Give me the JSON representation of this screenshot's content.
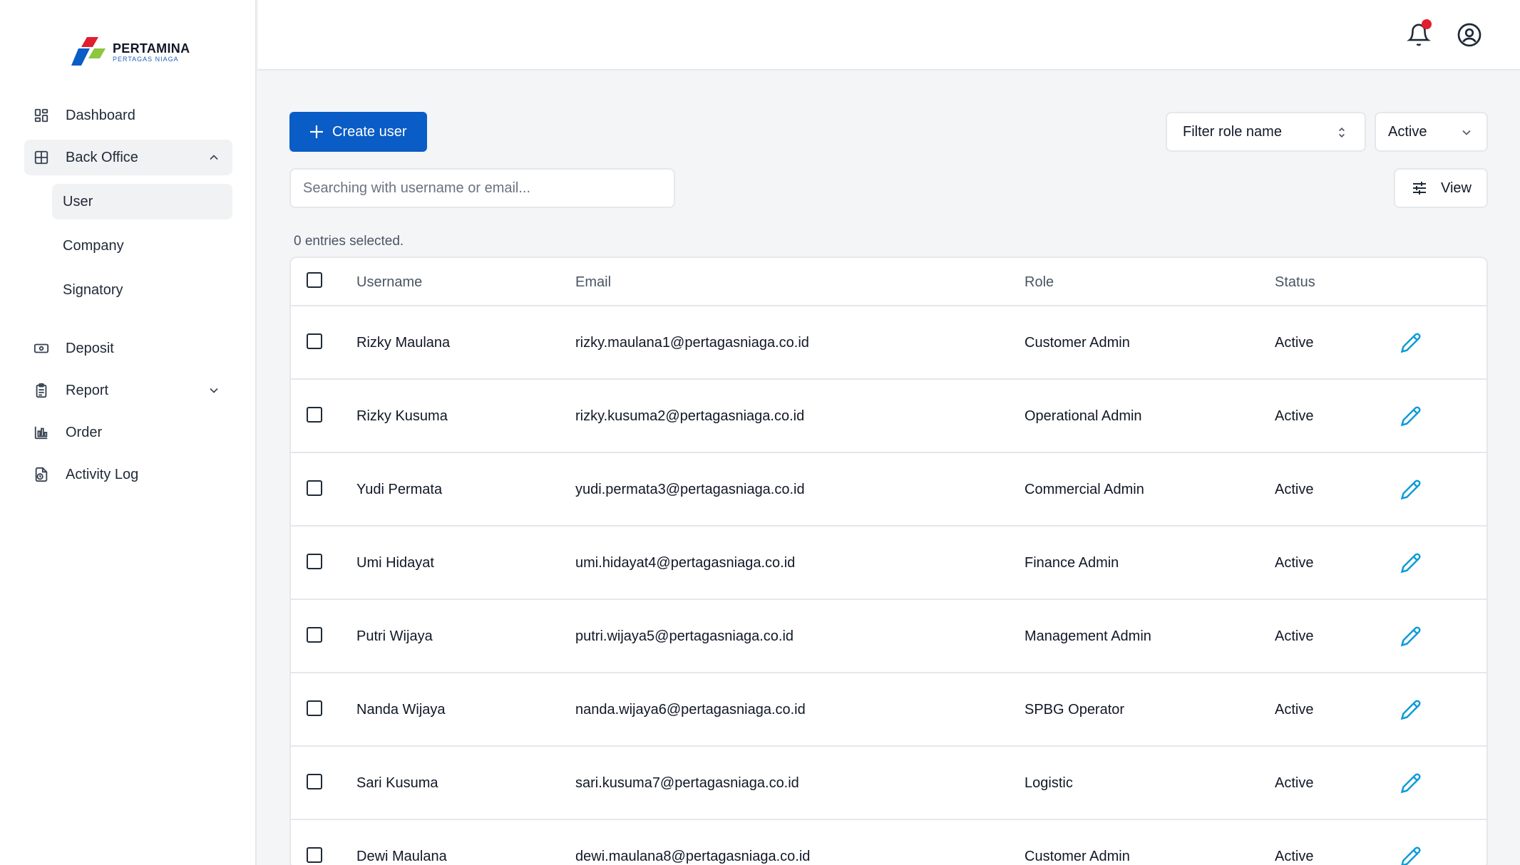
{
  "brand": {
    "name": "PERTAMINA",
    "subtitle": "PERTAGAS NIAGA"
  },
  "sidebar": {
    "items": [
      {
        "label": "Dashboard",
        "icon": "dashboard-grid-icon"
      },
      {
        "label": "Back Office",
        "icon": "table-grid-icon",
        "expanded": true,
        "children": [
          {
            "label": "User",
            "active": true
          },
          {
            "label": "Company"
          },
          {
            "label": "Signatory"
          }
        ]
      },
      {
        "label": "Deposit",
        "icon": "banknote-icon"
      },
      {
        "label": "Report",
        "icon": "clipboard-icon",
        "expanded": false
      },
      {
        "label": "Order",
        "icon": "bar-chart-icon"
      },
      {
        "label": "Activity Log",
        "icon": "file-clock-icon"
      }
    ]
  },
  "header": {
    "notification_icon": "bell-icon",
    "has_notification": true,
    "account_icon": "user-circle-icon"
  },
  "toolbar": {
    "create_label": "Create user",
    "role_filter_label": "Filter role name",
    "status_filter_value": "Active",
    "search_placeholder": "Searching with username or email...",
    "view_label": "View"
  },
  "selection": {
    "text": "0 entries selected."
  },
  "table": {
    "columns": [
      "Username",
      "Email",
      "Role",
      "Status"
    ],
    "rows": [
      {
        "username": "Rizky Maulana",
        "email": "rizky.maulana1@pertagasniaga.co.id",
        "role": "Customer Admin",
        "status": "Active"
      },
      {
        "username": "Rizky Kusuma",
        "email": "rizky.kusuma2@pertagasniaga.co.id",
        "role": "Operational Admin",
        "status": "Active"
      },
      {
        "username": "Yudi Permata",
        "email": "yudi.permata3@pertagasniaga.co.id",
        "role": "Commercial Admin",
        "status": "Active"
      },
      {
        "username": "Umi Hidayat",
        "email": "umi.hidayat4@pertagasniaga.co.id",
        "role": "Finance Admin",
        "status": "Active"
      },
      {
        "username": "Putri Wijaya",
        "email": "putri.wijaya5@pertagasniaga.co.id",
        "role": "Management Admin",
        "status": "Active"
      },
      {
        "username": "Nanda Wijaya",
        "email": "nanda.wijaya6@pertagasniaga.co.id",
        "role": "SPBG Operator",
        "status": "Active"
      },
      {
        "username": "Sari Kusuma",
        "email": "sari.kusuma7@pertagasniaga.co.id",
        "role": "Logistic",
        "status": "Active"
      },
      {
        "username": "Dewi Maulana",
        "email": "dewi.maulana8@pertagasniaga.co.id",
        "role": "Customer Admin",
        "status": "Active"
      }
    ]
  },
  "colors": {
    "primary": "#0a5cc6",
    "edit_icon": "#0e9bd8",
    "notification": "#e11d2e",
    "sidebar_active": "#f1f2f4",
    "page_bg": "#f4f5f7"
  }
}
